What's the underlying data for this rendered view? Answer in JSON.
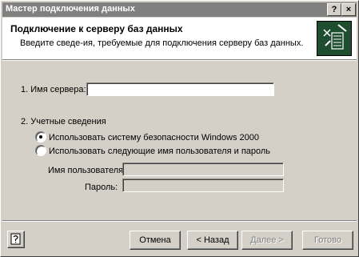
{
  "window": {
    "title": "Мастер подключения данных",
    "help_button": "?",
    "close_button": "×"
  },
  "header": {
    "title": "Подключение к серверу баз данных",
    "subtitle": "Введите сведе-ия, требуемые для подключения серверу баз данных."
  },
  "server": {
    "label": "1. Имя сервера:",
    "value": ""
  },
  "credentials": {
    "heading": "2. Учетные сведения",
    "option_windows": "Использовать систему безопасности Windows 2000",
    "option_user": "Использовать следующие имя пользователя и пароль",
    "selected": "windows",
    "username_label": "Имя пользователя:",
    "password_label": "Пароль:",
    "username_value": "",
    "password_value": ""
  },
  "buttons": {
    "cancel": "Отмена",
    "back": "< Назад",
    "next": "Далее >",
    "finish": "Готово"
  },
  "icons": {
    "logo": "database-connection-icon",
    "help": "help-icon"
  }
}
